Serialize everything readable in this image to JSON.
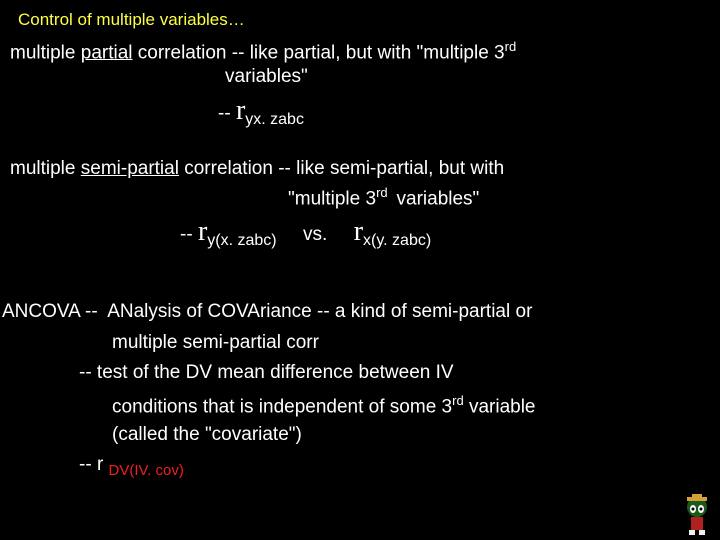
{
  "title": "Control of multiple variables…",
  "mp": {
    "pre": "multiple ",
    "partial": "partial",
    "post": " correlation -- like partial, but with \"multiple 3",
    "rd": "rd",
    "line2": "variables\"",
    "f_dashes": "-- ",
    "f_r": "r",
    "f_sub": "yx. zabc"
  },
  "msp": {
    "pre": "multiple ",
    "semi": "semi-partial",
    "post": " correlation -- like semi-partial, but with",
    "line2_a": "\"multiple 3",
    "rd": "rd ",
    "line2_b": " variables\"",
    "f_dashes": "-- ",
    "f_r1": "r",
    "f_sub1": "y(x. zabc)",
    "vs": "     vs.     ",
    "f_r2": "r",
    "f_sub2": "x(y. zabc)"
  },
  "anc": {
    "l1_a": "ANCOVA --  ANalysis of COVAriance -- a kind of semi-partial or",
    "l1_b": "multiple semi-partial corr",
    "l2": "--  test of the DV mean difference between IV",
    "l3_a": "conditions that is independent of some 3",
    "rd": "rd",
    "l3_b": " variable",
    "l4": "(called the \"covariate\")",
    "f_dashes": "-- ",
    "f_r": "r ",
    "f_sub": "DV(IV. cov)"
  }
}
